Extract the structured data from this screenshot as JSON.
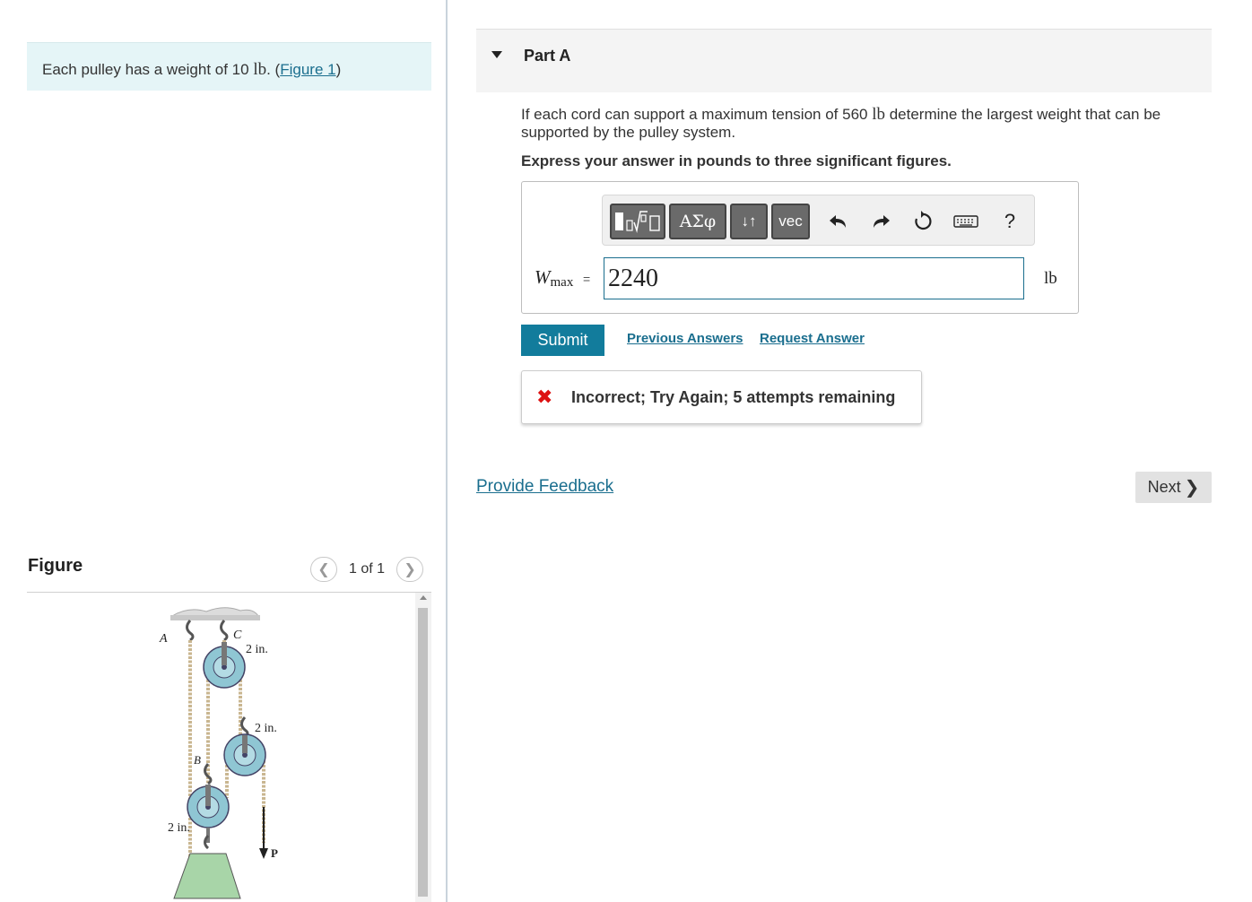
{
  "intro": {
    "text_prefix": "Each pulley has a weight of 10 ",
    "unit": "lb",
    "text_mid": ". (",
    "figure_link": "Figure 1",
    "text_suffix": ")"
  },
  "figure_panel": {
    "title": "Figure",
    "pager_text": "1 of 1",
    "prev_icon": "chevron-left-icon",
    "next_icon": "chevron-right-icon",
    "labels": {
      "A": "A",
      "B": "B",
      "C": "C",
      "top_dim": "2 in.",
      "mid_dim": "2 in.",
      "bottom_dim": "2 in.",
      "force": "P"
    }
  },
  "part": {
    "title": "Part A",
    "question_prefix": "If each cord can support a maximum tension of 560 ",
    "question_unit": "lb",
    "question_suffix": " determine the largest weight that can be supported by the pulley system.",
    "instruction": "Express your answer in pounds to three significant figures."
  },
  "toolbar": {
    "greek_label": "ΑΣφ",
    "arrows_label": "↓↑",
    "vec_label": "vec",
    "help_label": "?",
    "icons": [
      "templates-icon",
      "greek-icon",
      "arrows-icon",
      "vec-icon",
      "undo-icon",
      "redo-icon",
      "reset-icon",
      "keyboard-icon",
      "help-icon"
    ]
  },
  "answer": {
    "var_main": "W",
    "var_sub": "max",
    "equals": "=",
    "value": "2240",
    "unit": "lb"
  },
  "actions": {
    "submit": "Submit",
    "previous_answers": "Previous Answers",
    "request_answer": "Request Answer"
  },
  "feedback": {
    "icon": "x-icon",
    "message": "Incorrect; Try Again; 5 attempts remaining"
  },
  "footer": {
    "provide_feedback": "Provide Feedback",
    "next": "Next"
  },
  "colors": {
    "accent": "#127c9c",
    "link": "#1a6e8e",
    "error": "#dd1111",
    "intro_bg": "#e5f5f7",
    "pulley": "#8fc6d3",
    "weight": "#a8d5a8"
  }
}
